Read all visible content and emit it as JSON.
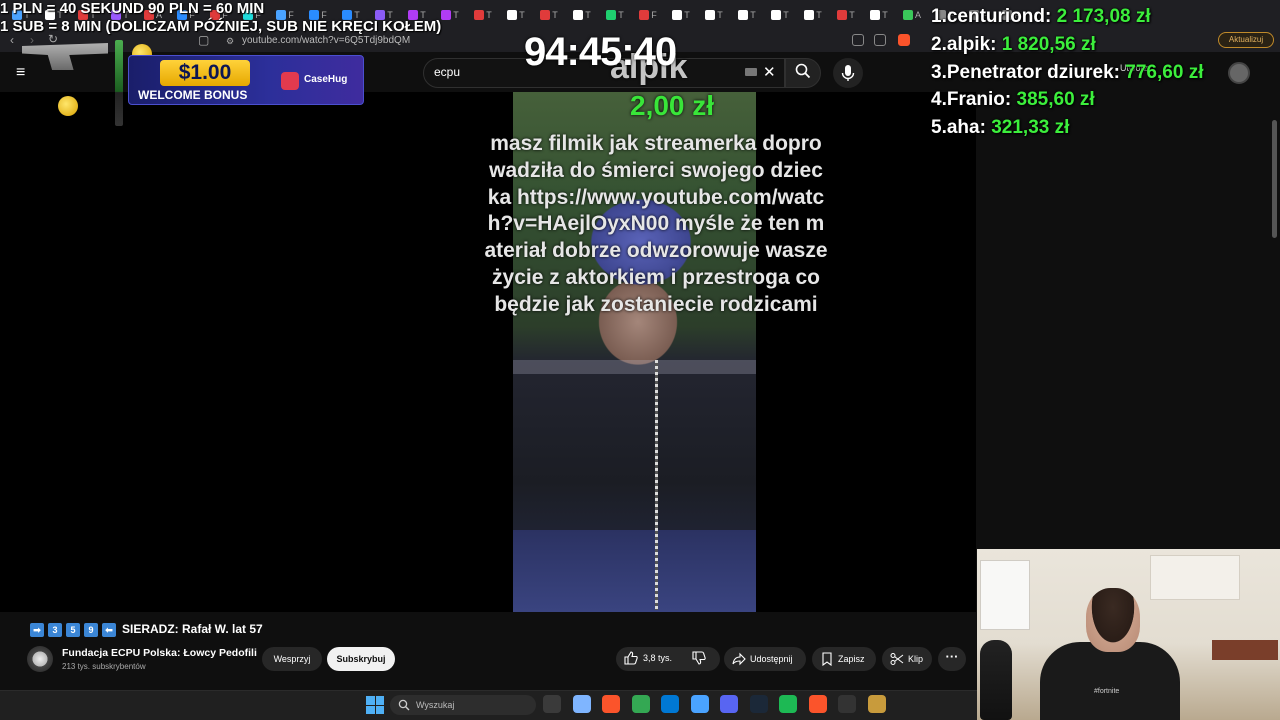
{
  "browser": {
    "url": "youtube.com/watch?v=6Q5Tdj9bdQM",
    "update_label": "Aktualizuj",
    "tab_letters": [
      "T",
      "T",
      "T",
      "T",
      "A",
      "F",
      "F",
      "F",
      "F",
      "F",
      "T",
      "T",
      "T",
      "T",
      "T",
      "T",
      "T",
      "T",
      "T",
      "F",
      "T",
      "T",
      "T"
    ],
    "tab_colors": [
      "#4aa3ff",
      "#ffffff",
      "#e03b3b",
      "#9b59ff",
      "#e03b3b",
      "#2a8cff",
      "#e03b3b",
      "#1fdcdc",
      "#4aa3ff",
      "#2a8cff",
      "#2a8cff",
      "#8b5cf6",
      "#b13cf5",
      "#b13cf5",
      "#e03b3b",
      "#ffffff",
      "#e03b3b",
      "#ffffff",
      "#1fd06f",
      "#e03b3b",
      "#ffffff",
      "#ffffff",
      "#ffffff",
      "#ffffff",
      "#ffffff",
      "#e03b3b",
      "#ffffff",
      "#3ac85a",
      "#888888",
      "#888888",
      "#888888"
    ]
  },
  "youtube": {
    "search_query": "ecpu",
    "create_label": "Utwórz"
  },
  "overlay": {
    "rules_line1": "1 PLN = 40 SEKUND 90 PLN = 60 MIN",
    "rules_line2": "1 SUB = 8 MIN (DOLICZAM PÓŹNIEJ, SUB NIE KRĘCI KOŁEM)",
    "timer": "94:45:40",
    "donor": "alpik",
    "donation_amount": "2,00 zł",
    "donation_message": "masz filmik jak streamerka doprowadziła do śmierci swojego dziecka https://www.youtube.com/watch?v=HAejlOyxN00 myśle że ten materiał dobrze odwzorowuje wasze życie z aktorkiem i przestroga co będzie jak zostaniecie rodzicami",
    "promo": {
      "amount": "$1.00",
      "text": "WELCOME BONUS",
      "brand": "CaseHug"
    },
    "leaderboard": [
      {
        "rank": "1.",
        "name": "centuriond:",
        "amount": "2 173,08 zł"
      },
      {
        "rank": "2.",
        "name": "alpik:",
        "amount": "1 820,56 zł"
      },
      {
        "rank": "3.",
        "name": "Penetrator dziurek:",
        "amount": "776,60 zł"
      },
      {
        "rank": "4.",
        "name": "Franio:",
        "amount": "385,60 zł"
      },
      {
        "rank": "5.",
        "name": "aha:",
        "amount": "321,33 zł"
      }
    ]
  },
  "video": {
    "title_badges": [
      "➡",
      "3",
      "5",
      "9",
      "⬅"
    ],
    "title": "SIERADZ: Rafał W. lat 57",
    "channel_name": "Fundacja ECPU Polska: Łowcy Pedofili",
    "channel_subs": "213 tys. subskrybentów",
    "support_label": "Wesprzyj",
    "subscribe_label": "Subskrybuj",
    "like_count": "3,8 tys.",
    "share_label": "Udostępnij",
    "save_label": "Zapisz",
    "clip_label": "Klip",
    "more_label": "···"
  },
  "webcam": {
    "shirt_text": "#fortnite"
  },
  "taskbar": {
    "search_placeholder": "Wyszukaj",
    "apps": [
      "task-view",
      "copilot",
      "brave",
      "chrome",
      "store",
      "notepad",
      "discord",
      "steam",
      "spotify",
      "brave-beta",
      "obs",
      "league"
    ],
    "app_colors": [
      "#3a3a3a",
      "#7fb5ff",
      "#fb542b",
      "#34a853",
      "#0078d4",
      "#4aa3ff",
      "#5865f2",
      "#1b2838",
      "#1db954",
      "#fb542b",
      "#333333",
      "#c89b3c"
    ]
  }
}
